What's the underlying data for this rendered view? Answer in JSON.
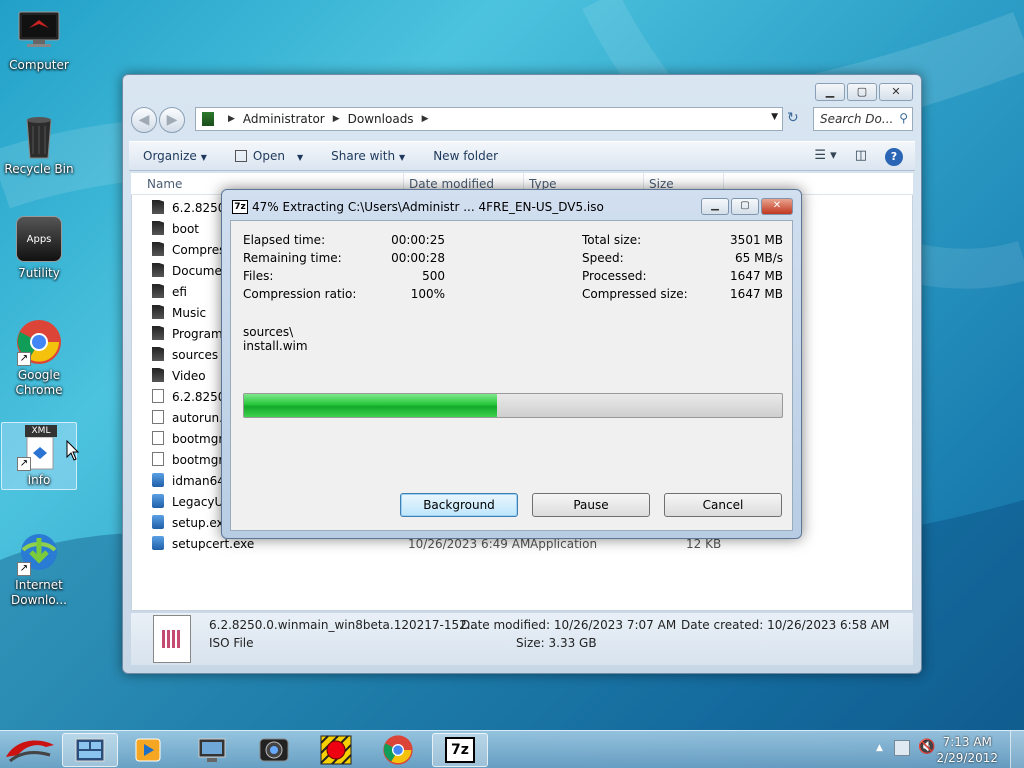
{
  "desktop": {
    "icons": [
      {
        "label": "Computer"
      },
      {
        "label": "Recycle Bin"
      },
      {
        "label": "7utility",
        "inner_text": "Apps"
      },
      {
        "label": "Google\nChrome"
      },
      {
        "label": "Info",
        "badge": "XML"
      },
      {
        "label": "Internet\nDownlo..."
      }
    ]
  },
  "explorer": {
    "address": {
      "segments": [
        "Administrator",
        "Downloads"
      ]
    },
    "search_placeholder": "Search Do...",
    "commands": {
      "organize": "Organize",
      "open": "Open",
      "share_with": "Share with",
      "new_folder": "New folder"
    },
    "columns": {
      "name": "Name",
      "date_modified": "Date modified",
      "type": "Type",
      "size": "Size"
    },
    "files": [
      {
        "name": "6.2.8250.0",
        "kind": "folder"
      },
      {
        "name": "boot",
        "kind": "folder"
      },
      {
        "name": "Compress",
        "kind": "folder"
      },
      {
        "name": "Documen",
        "kind": "folder"
      },
      {
        "name": "efi",
        "kind": "folder"
      },
      {
        "name": "Music",
        "kind": "folder"
      },
      {
        "name": "Programs",
        "kind": "folder"
      },
      {
        "name": "sources",
        "kind": "folder"
      },
      {
        "name": "Video",
        "kind": "folder"
      },
      {
        "name": "6.2.8250.0",
        "kind": "iso"
      },
      {
        "name": "autorun.i",
        "kind": "doc"
      },
      {
        "name": "bootmgr",
        "kind": "doc"
      },
      {
        "name": "bootmgr.",
        "kind": "doc"
      },
      {
        "name": "idman641",
        "kind": "exe"
      },
      {
        "name": "LegacyUp",
        "kind": "exe"
      },
      {
        "name": "setup.exe",
        "kind": "exe"
      },
      {
        "name": "setupcert.exe",
        "kind": "exe",
        "date": "10/26/2023 6:49 AM",
        "type": "Application",
        "size": "12 KB"
      }
    ],
    "details": {
      "filename": "6.2.8250.0.winmain_win8beta.120217-152...",
      "filetype": "ISO File",
      "date_modified": "Date modified: 10/26/2023 7:07 AM",
      "size": "Size: 3.33 GB",
      "date_created": "Date created: 10/26/2023 6:58 AM"
    }
  },
  "dialog": {
    "app_badge": "7z",
    "title": "47% Extracting C:\\Users\\Administr ... 4FRE_EN-US_DV5.iso",
    "progress_percent": 47,
    "stats_left": [
      {
        "label": "Elapsed time:",
        "value": "00:00:25"
      },
      {
        "label": "Remaining time:",
        "value": "00:00:28"
      },
      {
        "label": "Files:",
        "value": "500"
      },
      {
        "label": "Compression ratio:",
        "value": "100%"
      }
    ],
    "stats_right": [
      {
        "label": "Total size:",
        "value": "3501 MB"
      },
      {
        "label": "Speed:",
        "value": "65 MB/s"
      },
      {
        "label": "Processed:",
        "value": "1647 MB"
      },
      {
        "label": "Compressed size:",
        "value": "1647 MB"
      }
    ],
    "current_path": "sources\\",
    "current_file": "install.wim",
    "buttons": {
      "background": "Background",
      "pause": "Pause",
      "cancel": "Cancel"
    }
  },
  "taskbar": {
    "clock_time": "7:13 AM",
    "clock_date": "2/29/2012",
    "sevenzip_label": "7z"
  },
  "colors": {
    "desktop_bg": "#2d9fc7",
    "progress_green": "#28c83c",
    "title_accent": "#1e395b"
  }
}
